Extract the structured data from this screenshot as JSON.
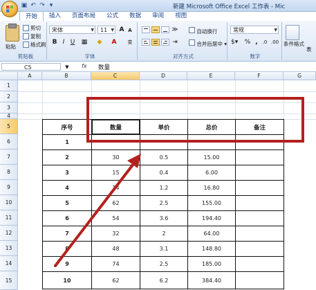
{
  "window": {
    "title": "新建 Microsoft Office Excel 工作表 - Mic"
  },
  "tabs": [
    "开始",
    "插入",
    "页面布局",
    "公式",
    "数据",
    "审阅",
    "视图"
  ],
  "ribbon": {
    "clipboard": {
      "paste": "粘贴",
      "cut": "剪切",
      "copy": "复制",
      "format_painter": "格式刷",
      "label": "剪贴板"
    },
    "font": {
      "name": "宋体",
      "size": "11",
      "label": "字体",
      "bold": "B",
      "italic": "I",
      "underline": "U",
      "grow": "A",
      "shrink": "A"
    },
    "alignment": {
      "wrap": "自动换行",
      "merge": "合并后居中",
      "label": "对齐方式"
    },
    "number": {
      "format": "常规",
      "percent": "%",
      "comma": ",",
      "label": "数字"
    },
    "styles": {
      "conditional": "条件格式",
      "table": "表"
    }
  },
  "formula_bar": {
    "cell": "C5",
    "fx": "fx",
    "value": "数量"
  },
  "columns": [
    "A",
    "B",
    "C",
    "D",
    "E",
    "F",
    "G"
  ],
  "rows": [
    "1",
    "2",
    "3",
    "4",
    "5",
    "6",
    "7",
    "8",
    "9",
    "10",
    "11",
    "12",
    "13",
    "14",
    "15"
  ],
  "table": {
    "headers": [
      "序号",
      "数量",
      "单价",
      "总价",
      "备注"
    ],
    "rows": [
      [
        "1",
        "",
        "",
        "",
        ""
      ],
      [
        "2",
        "30",
        "0.5",
        "15.00",
        ""
      ],
      [
        "3",
        "15",
        "0.4",
        "6.00",
        ""
      ],
      [
        "4",
        "14",
        "1.2",
        "16.80",
        ""
      ],
      [
        "5",
        "62",
        "2.5",
        "155.00",
        ""
      ],
      [
        "6",
        "54",
        "3.6",
        "194.40",
        ""
      ],
      [
        "7",
        "32",
        "2",
        "64.00",
        ""
      ],
      [
        "8",
        "48",
        "3.1",
        "148.80",
        ""
      ],
      [
        "9",
        "74",
        "2.5",
        "185.00",
        ""
      ],
      [
        "10",
        "62",
        "6.2",
        "384.40",
        ""
      ]
    ]
  },
  "colors": {
    "annotation": "#b3211e",
    "ribbon": "#dae6f5",
    "selected_header": "#f5c96a"
  }
}
